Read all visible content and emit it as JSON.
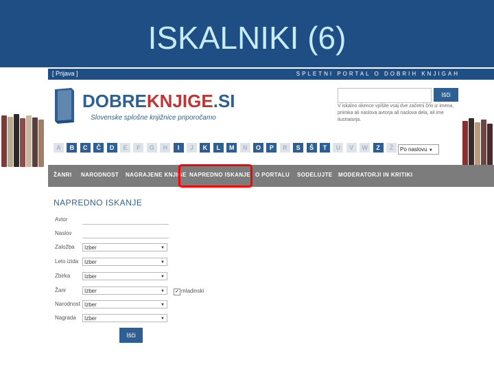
{
  "slide": {
    "title": "ISKALNIKI (6)"
  },
  "topbar": {
    "login": "[ Prijava ]",
    "portal": "SPLETNI PORTAL O DOBRIH KNJIGAH"
  },
  "logo": {
    "name_blue": "DOBRE",
    "name_red": "KNJIGE",
    "name_tail": ".SI",
    "subtitle": "Slovenske splošne knjižnice priporočamo"
  },
  "search": {
    "button": "Išči",
    "help": "V iskalno okence vpišite vsaj dve začetni črki iz imena, priimka ali naslova avtorja ali naslova dela, ali ime ilustratorja."
  },
  "alphabet": {
    "letters": [
      "A",
      "B",
      "C",
      "Č",
      "D",
      "E",
      "F",
      "G",
      "H",
      "I",
      "J",
      "K",
      "L",
      "M",
      "N",
      "O",
      "P",
      "R",
      "S",
      "Š",
      "T",
      "U",
      "V",
      "W",
      "Z",
      "Ž"
    ],
    "active": [
      false,
      true,
      true,
      true,
      true,
      false,
      false,
      false,
      false,
      true,
      false,
      true,
      true,
      true,
      false,
      true,
      true,
      false,
      true,
      true,
      true,
      false,
      false,
      false,
      true,
      false
    ],
    "sort": "Po naslovu"
  },
  "nav": {
    "items": [
      "ŽANRI",
      "NARODNOST",
      "NAGRAJENE KNJIGE",
      "NAPREDNO ISKANJE",
      "O PORTALU",
      "SODELUJTE",
      "MODERATORJI IN KRITIKI"
    ]
  },
  "form": {
    "title": "NAPREDNO ISKANJE",
    "fields": [
      {
        "label": "Avtor"
      },
      {
        "label": "Naslov"
      },
      {
        "label": "Založba",
        "value": "Izber"
      },
      {
        "label": "Leto izida",
        "value": "Izber"
      },
      {
        "label": "Zbirka",
        "value": "Izber"
      },
      {
        "label": "Žanr",
        "value": "Izber"
      },
      {
        "label": "Narodnost",
        "value": "Izber"
      },
      {
        "label": "Nagrada",
        "value": "Izber"
      }
    ],
    "checkbox_label": "mladinski",
    "submit": "Išči"
  },
  "colors": {
    "header": "#1f4e84",
    "brand_blue": "#2d5f95",
    "brand_red": "#c13434",
    "nav": "#7c7c7c",
    "highlight": "#ff0000"
  }
}
